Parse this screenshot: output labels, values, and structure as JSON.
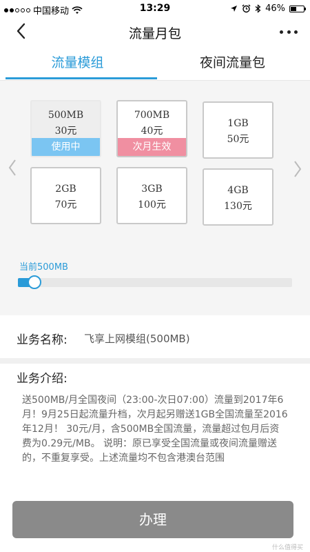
{
  "status_bar": {
    "carrier": "中国移动",
    "time": "13:29",
    "battery": "46%",
    "battery_level": 0.46
  },
  "header": {
    "title": "流量月包",
    "back_icon": "chevron-left-icon",
    "more_icon": "more-dots-icon"
  },
  "tabs": [
    {
      "label": "流量模组",
      "active": true
    },
    {
      "label": "夜间流量包",
      "active": false
    }
  ],
  "plans": [
    {
      "data": "500MB",
      "price": "30元",
      "tag": "使用中"
    },
    {
      "data": "700MB",
      "price": "40元",
      "tag": "次月生效"
    },
    {
      "data": "1GB",
      "price": "50元",
      "tag": ""
    },
    {
      "data": "2GB",
      "price": "70元",
      "tag": ""
    },
    {
      "data": "3GB",
      "price": "100元",
      "tag": ""
    },
    {
      "data": "4GB",
      "price": "130元",
      "tag": ""
    }
  ],
  "colors": {
    "accent": "#2a9bd8",
    "in_use_tag": "#7bc5f2",
    "next_month_tag": "#f08fa1",
    "submit_button": "#8a8a8a"
  },
  "slider": {
    "label": "当前500MB",
    "fraction": 0.03
  },
  "service": {
    "name_label": "业务名称:",
    "name_value": "飞享上网模组(500MB)",
    "desc_label": "业务介绍:",
    "description": "送500MB/月全国夜间（23:00-次日07:00）流量到2017年6月！9月25日起流量升档，次月起另赠送1GB全国流量至2016年12月！ 30元/月，含500MB全国流量，流量超过包月后资费为0.29元/MB。 说明：原已享受全国流量或夜间流量赠送的，不重复享受。上述流量均不包含港澳台范围"
  },
  "submit_label": "办理",
  "watermark": "什么值得买"
}
